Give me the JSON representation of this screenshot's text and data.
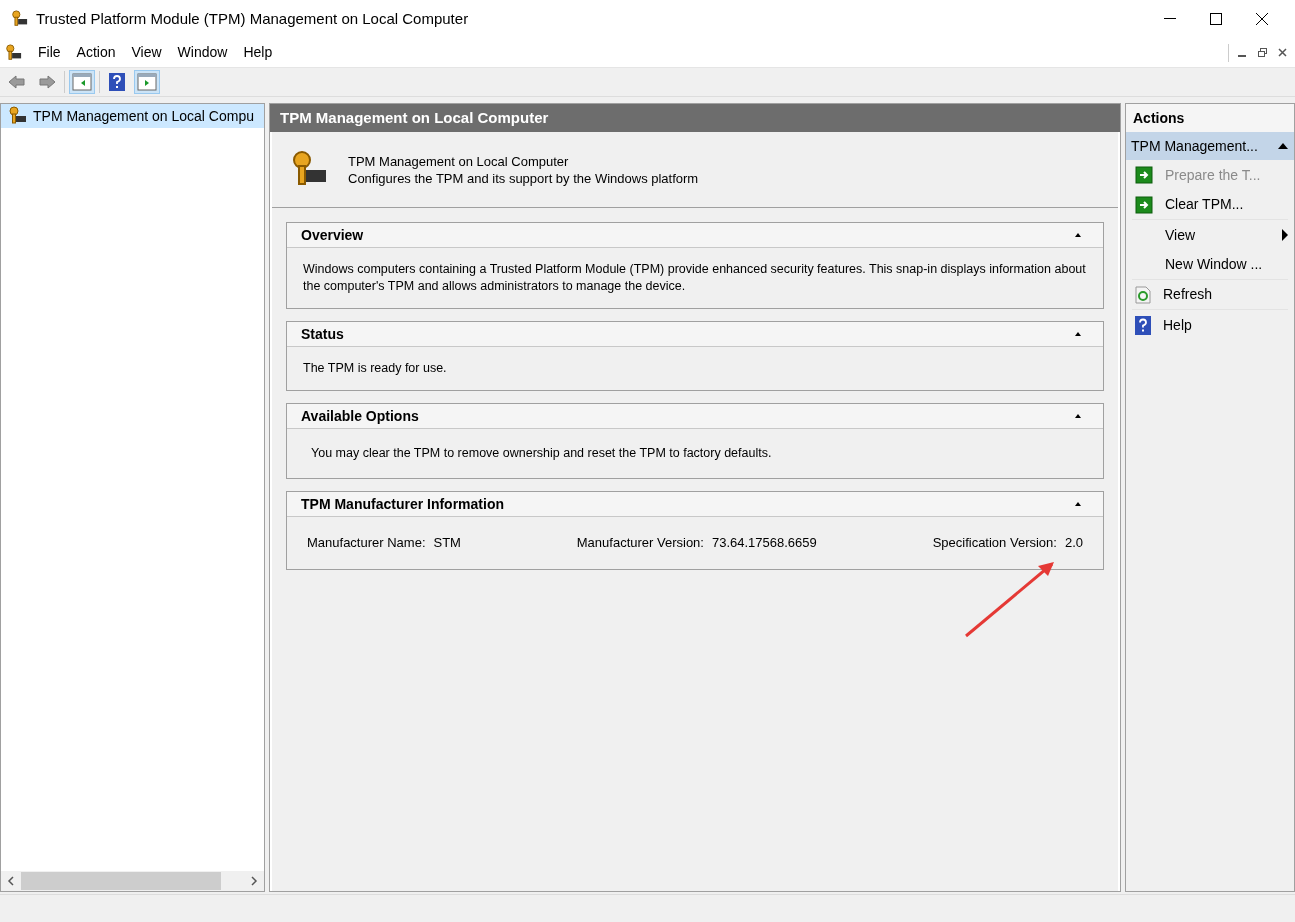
{
  "window": {
    "title": "Trusted Platform Module (TPM) Management on Local Computer"
  },
  "menu": [
    "File",
    "Action",
    "View",
    "Window",
    "Help"
  ],
  "toolbar": [
    {
      "kind": "back",
      "pressed": false
    },
    {
      "kind": "forward",
      "pressed": false
    },
    {
      "kind": "tree",
      "pressed": true
    },
    {
      "kind": "help",
      "pressed": false
    },
    {
      "kind": "action",
      "pressed": true
    }
  ],
  "tree": {
    "items": [
      {
        "label": "TPM Management on Local Compu",
        "selected": true
      }
    ]
  },
  "center": {
    "header": "TPM Management on Local Computer",
    "intro_title": "TPM Management on Local Computer",
    "intro_subtitle": "Configures the TPM and its support by the Windows platform",
    "sections": [
      {
        "kind": "text",
        "title": "Overview",
        "expanded": true,
        "text": "Windows computers containing a Trusted Platform Module (TPM) provide enhanced security features. This snap-in displays information about the computer's TPM and allows administrators to manage the device."
      },
      {
        "kind": "text",
        "title": "Status",
        "expanded": true,
        "text": "The TPM is ready for use."
      },
      {
        "kind": "text",
        "title": "Available Options",
        "expanded": true,
        "text": "You may clear the TPM to remove ownership and reset the TPM to factory defaults."
      },
      {
        "kind": "fields",
        "title": "TPM Manufacturer Information",
        "expanded": true,
        "fields": [
          {
            "label": "Manufacturer Name:",
            "value": "STM"
          },
          {
            "label": "Manufacturer Version:",
            "value": "73.64.17568.6659"
          },
          {
            "label": "Specification Version:",
            "value": "2.0"
          }
        ]
      }
    ]
  },
  "actions": {
    "header": "Actions",
    "group": {
      "label": "TPM Management...",
      "expanded": true
    },
    "items": [
      {
        "label": "Prepare the T...",
        "kind": "arrow",
        "disabled": true,
        "submenu": false,
        "divider_after": false
      },
      {
        "label": "Clear TPM...",
        "kind": "arrow",
        "disabled": false,
        "submenu": false,
        "divider_after": true
      },
      {
        "label": "View",
        "kind": "plain",
        "disabled": false,
        "submenu": true,
        "divider_after": false
      },
      {
        "label": "New Window ...",
        "kind": "plain",
        "disabled": false,
        "submenu": false,
        "divider_after": true
      },
      {
        "label": "Refresh",
        "kind": "refresh",
        "disabled": false,
        "submenu": false,
        "divider_after": true
      },
      {
        "label": "Help",
        "kind": "help",
        "disabled": false,
        "submenu": false,
        "divider_after": false
      }
    ]
  }
}
